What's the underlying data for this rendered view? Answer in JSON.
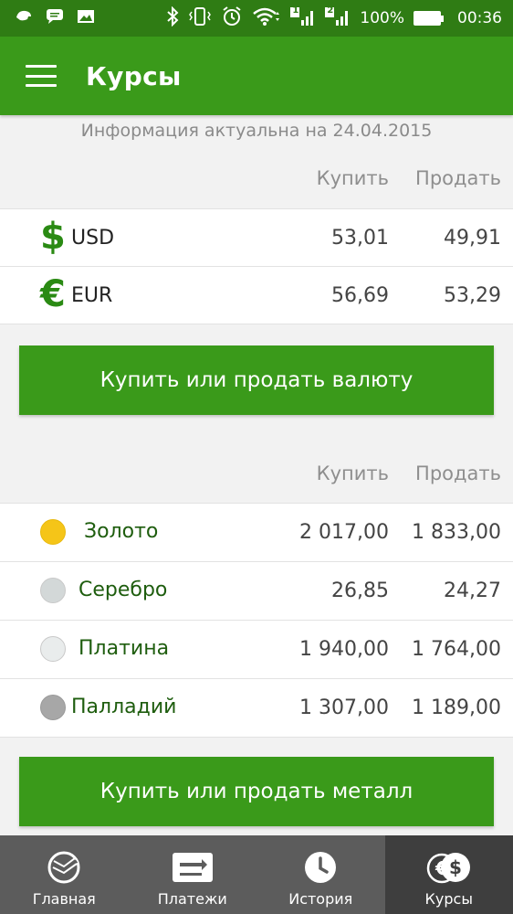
{
  "status_bar": {
    "battery": "100%",
    "time": "00:36",
    "sim1": "1",
    "sim2": "2"
  },
  "header": {
    "title": "Курсы"
  },
  "info_text": "Информация актуальна на 24.04.2015",
  "currency_section": {
    "col_buy": "Купить",
    "col_sell": "Продать",
    "rows": [
      {
        "symbol": "$",
        "code": "USD",
        "buy": "53,01",
        "sell": "49,91"
      },
      {
        "symbol": "€",
        "code": "EUR",
        "buy": "56,69",
        "sell": "53,29"
      }
    ],
    "action_label": "Купить или продать валюту"
  },
  "metal_section": {
    "col_buy": "Купить",
    "col_sell": "Продать",
    "rows": [
      {
        "name": "Золото",
        "color": "#f5c518",
        "buy": "2 017,00",
        "sell": "1 833,00"
      },
      {
        "name": "Серебро",
        "color": "#d3d8d8",
        "buy": "26,85",
        "sell": "24,27"
      },
      {
        "name": "Платина",
        "color": "#e9ecec",
        "buy": "1 940,00",
        "sell": "1 764,00"
      },
      {
        "name": "Палладий",
        "color": "#a7a7a7",
        "buy": "1 307,00",
        "sell": "1 189,00"
      }
    ],
    "action_label": "Купить или продать металл"
  },
  "bottom_nav": {
    "items": [
      {
        "label": "Главная",
        "icon": "sberbank-logo-icon"
      },
      {
        "label": "Платежи",
        "icon": "payments-icon"
      },
      {
        "label": "История",
        "icon": "clock-icon"
      },
      {
        "label": "Курсы",
        "icon": "currency-exchange-icon"
      }
    ]
  },
  "colors": {
    "status_bar": "#2f7c14",
    "app_bar": "#3a9a1a",
    "accent": "#2a8a13",
    "nav_bg": "#5c5c5c",
    "nav_active": "#3e3e3e"
  }
}
